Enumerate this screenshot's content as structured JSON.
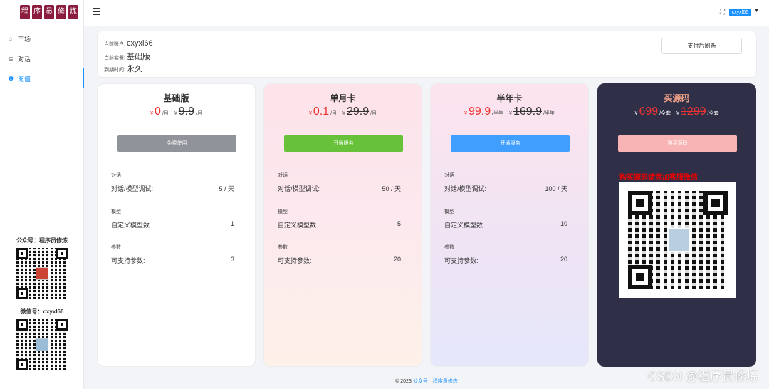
{
  "logo_chars": [
    "程",
    "序",
    "员",
    "修",
    "炼"
  ],
  "sidebar": {
    "items": [
      {
        "label": "市场",
        "icon": "home-icon"
      },
      {
        "label": "对话",
        "icon": "chat-icon"
      },
      {
        "label": "充值",
        "icon": "recharge-icon"
      }
    ],
    "qr1_caption": "公众号：程序员修炼",
    "qr2_caption": "微信号：cxyxl66"
  },
  "header": {
    "username": "cxyxl66",
    "icons": [
      "menu-icon",
      "fullscreen-icon",
      "caret-down-icon"
    ]
  },
  "account": {
    "account_label": "当前账户:",
    "account_value": "cxyxl66",
    "plan_label": "当前套餐:",
    "plan_value": "基础版",
    "expire_label": "到期时间:",
    "expire_value": "永久",
    "refresh_button": "支付后刷新"
  },
  "currency": "¥",
  "plans": [
    {
      "title": "基础版",
      "price": "0",
      "unit": "/月",
      "orig_price": "9.9",
      "orig_unit": "/月",
      "button": "免费使用",
      "button_color": "#909399",
      "features": {
        "chat_cat": "对话",
        "chat_label": "对话/模型调试:",
        "chat_value": "5 / 天",
        "model_cat": "模型",
        "model_label": "自定义模型数:",
        "model_value": "1",
        "param_cat": "参数",
        "param_label": "可支持参数:",
        "param_value": "3"
      }
    },
    {
      "title": "单月卡",
      "price": "0.1",
      "unit": "/月",
      "orig_price": "29.9",
      "orig_unit": "/月",
      "button": "开通服务",
      "button_color": "#67c23a",
      "features": {
        "chat_cat": "对话",
        "chat_label": "对话/模型调试:",
        "chat_value": "50 / 天",
        "model_cat": "模型",
        "model_label": "自定义模型数:",
        "model_value": "5",
        "param_cat": "参数",
        "param_label": "可支持参数:",
        "param_value": "20"
      }
    },
    {
      "title": "半年卡",
      "price": "99.9",
      "unit": "/半年",
      "orig_price": "169.9",
      "orig_unit": "/半年",
      "button": "开通服务",
      "button_color": "#409eff",
      "features": {
        "chat_cat": "对话",
        "chat_label": "对话/模型调试:",
        "chat_value": "100 / 天",
        "model_cat": "模型",
        "model_label": "自定义模型数:",
        "model_value": "10",
        "param_cat": "参数",
        "param_label": "可支持参数:",
        "param_value": "20"
      }
    },
    {
      "title": "买源码",
      "price": "699",
      "unit": "/全套",
      "orig_price": "1299",
      "orig_unit": "/全套",
      "button": "购买源码",
      "button_color": "#f8b4b4",
      "promo": "购买源码请添加客服微信"
    }
  ],
  "footer": {
    "copyright": "© 2023",
    "link": "公众号：程序员修炼"
  },
  "watermark": "CSDN @程序员修炼"
}
